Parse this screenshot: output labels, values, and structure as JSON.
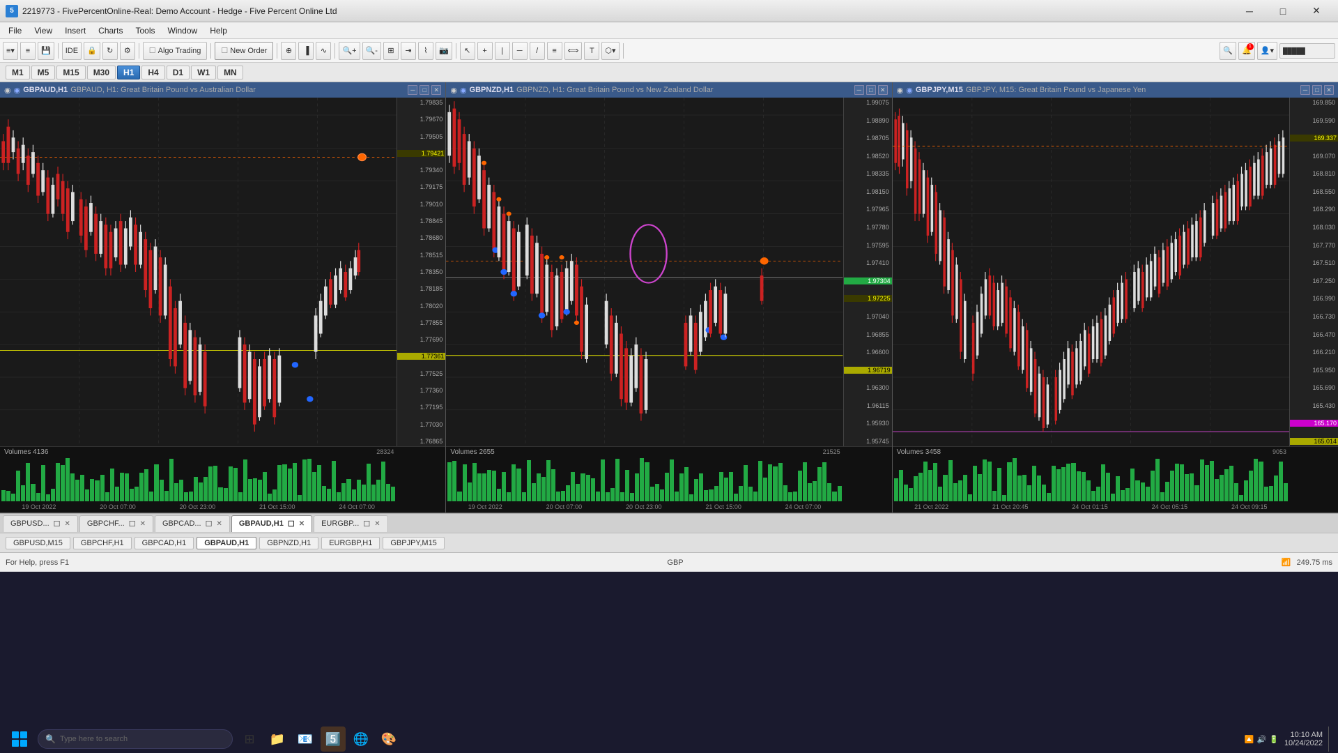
{
  "titlebar": {
    "title": "2219773 - FivePercentOnline-Real: Demo Account - Hedge - Five Percent Online Ltd",
    "app_icon": "5",
    "minimize": "─",
    "maximize": "□",
    "close": "✕"
  },
  "menubar": {
    "items": [
      "File",
      "View",
      "Insert",
      "Charts",
      "Tools",
      "Window",
      "Help"
    ]
  },
  "toolbar": {
    "algo_trading": "Algo Trading",
    "new_order": "New Order"
  },
  "timeframes": {
    "buttons": [
      "M1",
      "M5",
      "M15",
      "M30",
      "H1",
      "H4",
      "D1",
      "W1",
      "MN"
    ],
    "active": "H1"
  },
  "charts": [
    {
      "id": "chart1",
      "symbol": "GBPAUD,H1",
      "title": "GBPAUD, H1: Great Britain Pound vs Australian Dollar",
      "prices": {
        "high": "1.79835",
        "p1": "1.79670",
        "p2": "1.79505",
        "p3": "1.79421",
        "p4": "1.79340",
        "p5": "1.79175",
        "p6": "1.79010",
        "p7": "1.78845",
        "p8": "1.78680",
        "p9": "1.78515",
        "p10": "1.78350",
        "p11": "1.78185",
        "p12": "1.78020",
        "p13": "1.77855",
        "p14": "1.77690",
        "p15": "1.77361",
        "p16": "1.77525",
        "p17": "1.77360",
        "p18": "1.77195",
        "p19": "1.77030",
        "p20": "1.76865",
        "current": "1.79421"
      },
      "volume": {
        "label": "Volumes 4136",
        "max": "28324"
      },
      "time_labels": [
        "19 Oct 2022",
        "20 Oct 07:00",
        "20 Oct 23:00",
        "21 Oct 15:00",
        "24 Oct 07:00"
      ]
    },
    {
      "id": "chart2",
      "symbol": "GBPNZD,H1",
      "title": "GBPNZD, H1: Great Britain Pound vs New Zealand Dollar",
      "prices": {
        "high": "1.99075",
        "p1": "1.98890",
        "p2": "1.98705",
        "p3": "1.98520",
        "p4": "1.98335",
        "p5": "1.98150",
        "p6": "1.97965",
        "p7": "1.97780",
        "p8": "1.97595",
        "p9": "1.97410",
        "p10": "1.97304",
        "p11": "1.97225",
        "p12": "1.97040",
        "p13": "1.96855",
        "p14": "1.96600",
        "p15": "1.96719",
        "p16": "1.96300",
        "p17": "1.96115",
        "p18": "1.95930",
        "p19": "1.95745",
        "current": "1.97304"
      },
      "volume": {
        "label": "Volumes 2655",
        "max": "21525"
      },
      "time_labels": [
        "19 Oct 2022",
        "20 Oct 07:00",
        "20 Oct 23:00",
        "21 Oct 15:00",
        "24 Oct 07:00"
      ]
    },
    {
      "id": "chart3",
      "symbol": "GBPJPY,M15",
      "title": "GBPJPY, M15: Great Britain Pound vs Japanese Yen",
      "prices": {
        "high": "169.850",
        "p1": "169.590",
        "p2": "169.337",
        "p3": "169.070",
        "p4": "168.810",
        "p5": "168.550",
        "p6": "168.290",
        "p7": "168.030",
        "p8": "167.770",
        "p9": "167.510",
        "p10": "167.250",
        "p11": "166.990",
        "p12": "166.730",
        "p13": "166.470",
        "p14": "166.210",
        "p15": "165.950",
        "p16": "165.690",
        "p17": "165.430",
        "p18": "165.170",
        "p19": "165.014",
        "current": "169.337"
      },
      "volume": {
        "label": "Volumes 3458",
        "max": "9053"
      },
      "time_labels": [
        "21 Oct 2022",
        "21 Oct 20:45",
        "24 Oct 01:15",
        "24 Oct 05:15",
        "24 Oct 09:15"
      ]
    }
  ],
  "chart_tabs": [
    {
      "label": "GBPUSD...",
      "active": false
    },
    {
      "label": "GBPCHF...",
      "active": false
    },
    {
      "label": "GBPCAD...",
      "active": false
    },
    {
      "label": "GBPAUD,H1",
      "active": true
    },
    {
      "label": "EURGBP...",
      "active": false
    }
  ],
  "bottom_tabs": [
    {
      "label": "GBPUSD,M15",
      "active": false
    },
    {
      "label": "GBPCHF,H1",
      "active": false
    },
    {
      "label": "GBPCAD,H1",
      "active": false
    },
    {
      "label": "GBPAUD,H1",
      "active": true
    },
    {
      "label": "GBPNZD,H1",
      "active": false
    },
    {
      "label": "EURGBP,H1",
      "active": false
    },
    {
      "label": "GBPJPY,M15",
      "active": false
    }
  ],
  "statusbar": {
    "help_text": "For Help, press F1",
    "currency": "GBP",
    "ping": "249.75 ms"
  },
  "taskbar": {
    "search_placeholder": "Type here to search",
    "time": "10:10 AM",
    "date": "10/24/2022"
  }
}
